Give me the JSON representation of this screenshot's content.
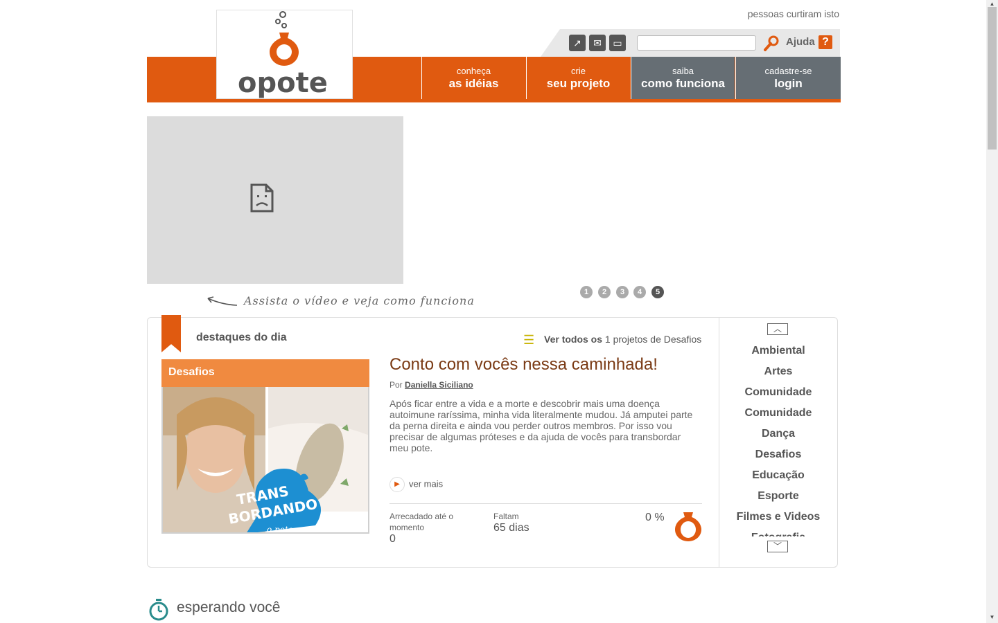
{
  "header": {
    "likes_text": "pessoas curtiram isto",
    "help_label": "Ajuda",
    "help_icon": "?",
    "search": {
      "value": "",
      "placeholder": ""
    },
    "logo_text": "opote"
  },
  "nav": [
    {
      "small": "conheça",
      "big": "as idéias"
    },
    {
      "small": "crie",
      "big": "seu projeto"
    },
    {
      "small": "saiba",
      "big": "como funciona"
    },
    {
      "small": "cadastre-se",
      "big": "login"
    }
  ],
  "hero": {
    "watch_hint": "Assista o vídeo e veja como funciona",
    "pages": [
      "1",
      "2",
      "3",
      "4",
      "5"
    ],
    "active_page": 5
  },
  "highlights": {
    "title": "destaques do dia",
    "see_all": {
      "prefix": "Ver todos os",
      "count": "1",
      "suffix": "projetos de Desafios"
    },
    "category": "Desafios",
    "image_caption": {
      "line1": "TRANS",
      "line2": "BORDANDO",
      "line3": "o pote"
    },
    "project": {
      "title": "Conto com vocês nessa caminhada!",
      "by_label": "Por",
      "author": "Daniella Siciliano",
      "description": "Após ficar entre a vida e a morte e descobrir mais uma doença autoimune raríssima, minha vida literalmente mudou. Já amputei parte da perna direita e ainda vou perder outros membros. Por isso vou precisar de algumas próteses e da ajuda de vocês para transbordar meu pote.",
      "ver_mais": "ver mais",
      "raised_label": "Arrecadado até o momento",
      "raised_value": "0",
      "remaining_label": "Faltam",
      "remaining_value": "65 dias",
      "percent": "0 %"
    },
    "categories": [
      "Ambiental",
      "Artes",
      "Comunidade",
      "Comunidade",
      "Dança",
      "Desafios",
      "Educação",
      "Esporte",
      "Filmes e Videos",
      "Fotografia"
    ]
  },
  "waiting": {
    "title": "esperando você"
  },
  "colors": {
    "brand_orange": "#e05a10",
    "nav_gray": "#666e74",
    "title_brown": "#7a3a14"
  }
}
